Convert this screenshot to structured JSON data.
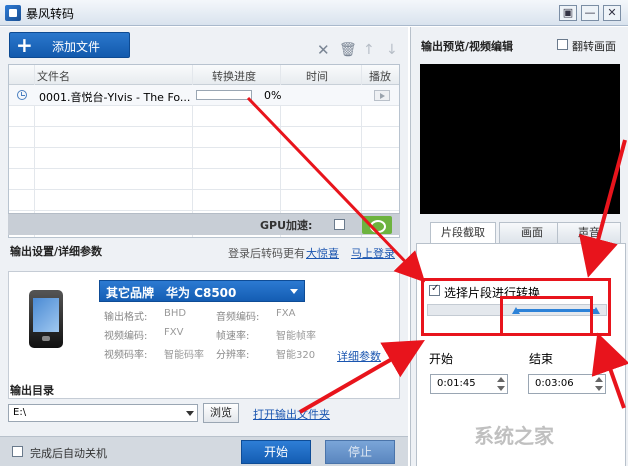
{
  "window": {
    "title": "暴风转码",
    "buttons": [
      "▣",
      "—",
      "✕"
    ]
  },
  "toolbar": {
    "add_file_label": "添加文件",
    "icons": [
      "close-icon",
      "trash-icon",
      "up-arrow-icon",
      "down-arrow-icon"
    ]
  },
  "filelist": {
    "columns": [
      "文件名",
      "转换进度",
      "时间",
      "播放"
    ],
    "rows": [
      {
        "name": "0001.音悦台-Ylvis - The Fo...",
        "progress_text": "0%",
        "progress": 0
      }
    ]
  },
  "gpu": {
    "label": "GPU加速:",
    "checked": false
  },
  "output_settings": {
    "title": "输出设置/详细参数",
    "hint": "登录后转码更有",
    "surprise_link": "大惊喜",
    "login_link": "马上登录",
    "brand": "其它品牌",
    "model": "华为 C8500",
    "params": [
      {
        "label": "输出格式:",
        "value": "BHD"
      },
      {
        "label": "音频编码:",
        "value": "FXA"
      },
      {
        "label": "视频编码:",
        "value": "FXV"
      },
      {
        "label": "帧速率:",
        "value": "智能帧率"
      },
      {
        "label": "视频码率:",
        "value": "智能码率"
      },
      {
        "label": "分辨率:",
        "value": "智能320"
      }
    ],
    "detail_link": "详细参数"
  },
  "output_dir": {
    "title": "输出目录",
    "path": "E:\\",
    "browse_label": "浏览",
    "open_link": "打开输出文件夹"
  },
  "footer": {
    "shutdown_label": "完成后自动关机",
    "start_label": "开始",
    "stop_label": "停止"
  },
  "right_panel": {
    "title": "输出预览/视频编辑",
    "flip_label": "翻转画面",
    "tabs": [
      "片段截取",
      "画面",
      "声音"
    ],
    "clip_checkbox_label": "选择片段进行转换",
    "clip_checked": true,
    "start_label": "开始",
    "end_label": "结束",
    "start_time": "0:01:45",
    "end_time": "0:03:06"
  },
  "watermark": "系统之家",
  "colors": {
    "accent": "#1a5fb4",
    "annotation": "#e8141c"
  }
}
